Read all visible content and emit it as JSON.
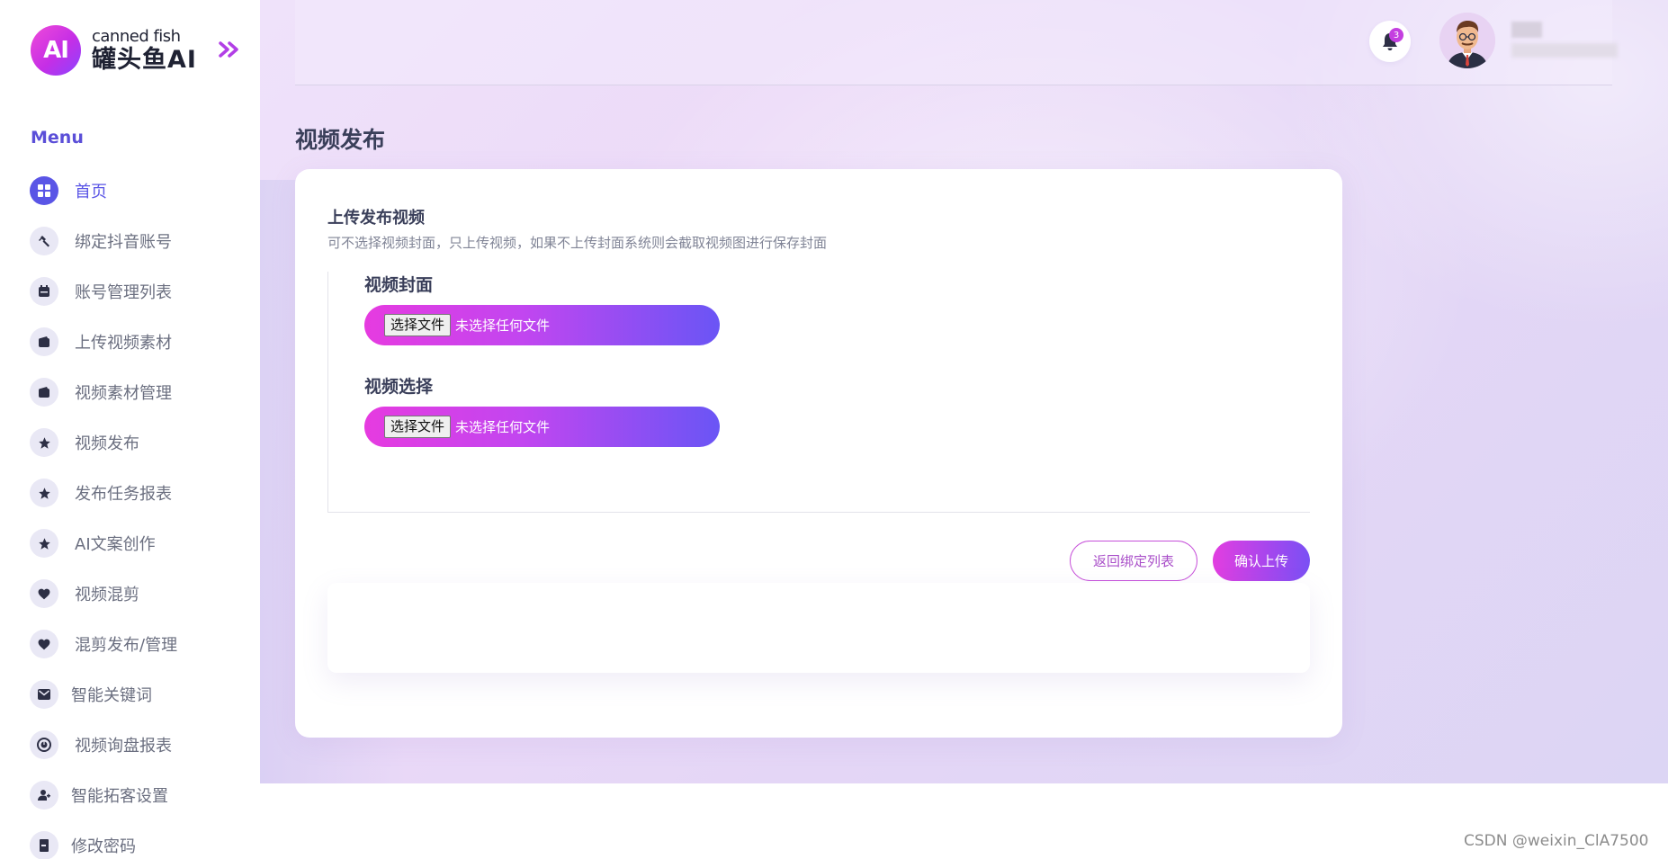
{
  "brand": {
    "logo_mark": "AI",
    "name_en": "canned fish",
    "name_cn": "罐头鱼AI"
  },
  "sidebar": {
    "menu_title": "Menu",
    "items": [
      {
        "label": "首页",
        "icon": "dashboard-icon",
        "active": true
      },
      {
        "label": "绑定抖音账号",
        "icon": "hammer-icon"
      },
      {
        "label": "账号管理列表",
        "icon": "calendar-icon"
      },
      {
        "label": "上传视频素材",
        "icon": "wallet-icon"
      },
      {
        "label": "视频素材管理",
        "icon": "wallet-icon"
      },
      {
        "label": "视频发布",
        "icon": "star-icon"
      },
      {
        "label": "发布任务报表",
        "icon": "star-icon"
      },
      {
        "label": "AI文案创作",
        "icon": "star-icon"
      },
      {
        "label": "视频混剪",
        "icon": "heart-icon"
      },
      {
        "label": "混剪发布/管理",
        "icon": "heart-icon"
      },
      {
        "label": "智能关键词",
        "icon": "envelope-icon"
      },
      {
        "label": "视频询盘报表",
        "icon": "clock-icon"
      },
      {
        "label": "智能拓客设置",
        "icon": "user-plus-icon"
      },
      {
        "label": "修改密码",
        "icon": "door-icon"
      }
    ]
  },
  "header": {
    "notification_count": "3"
  },
  "page": {
    "title": "视频发布"
  },
  "card": {
    "title": "上传发布视频",
    "subtitle": "可不选择视频封面，只上传视频，如果不上传封面系统则会截取视频图进行保存封面",
    "cover_label": "视频封面",
    "video_label": "视频选择",
    "choose_file": "选择文件",
    "no_file": "未选择任何文件",
    "back_button": "返回绑定列表",
    "confirm_button": "确认上传"
  },
  "watermark": "CSDN @weixin_ClA7500",
  "colors": {
    "accent": "#5a55e6",
    "gradient_start": "#e63be0",
    "gradient_end": "#6a55f5"
  }
}
